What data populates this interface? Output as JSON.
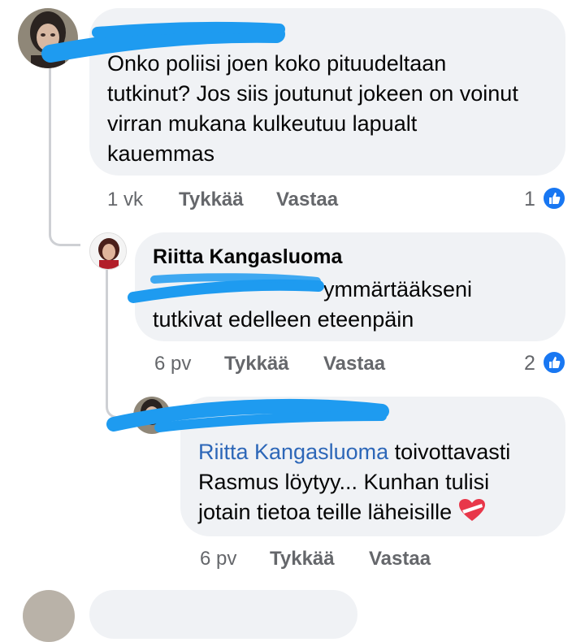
{
  "comments": [
    {
      "author": "",
      "text": "Onko poliisi joen koko pituudeltaan tutkinut? Jos siis joutunut jokeen on voinut virran mukana kulkeutuu lapualt kauemmas",
      "time": "1 vk",
      "like_label": "Tykkää",
      "reply_label": "Vastaa",
      "like_count": "1"
    },
    {
      "author": "Riitta Kangasluoma",
      "mention": "",
      "text": "ymmärtääkseni tutkivat edelleen eteenpäin",
      "time": "6 pv",
      "like_label": "Tykkää",
      "reply_label": "Vastaa",
      "like_count": "2"
    },
    {
      "author": "",
      "mention": "Riitta Kangasluoma",
      "text": "toivottavasti Rasmus löytyy... Kunhan tulisi jotain tietoa teille läheisille",
      "emoji_icon": "heart-icon",
      "time": "6 pv",
      "like_label": "Tykkää",
      "reply_label": "Vastaa"
    }
  ],
  "colors": {
    "bubble": "#f0f2f5",
    "mention": "#2d67b8",
    "meta": "#65676b",
    "like_badge": "#1877f2",
    "redaction": "#1e9bf0"
  }
}
